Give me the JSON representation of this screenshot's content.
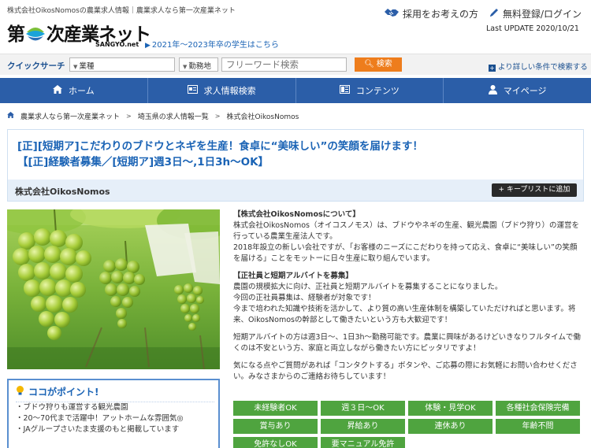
{
  "header": {
    "tagline": "株式会社OikosNomosの農業求人情報｜農業求人なら第一次産業ネット",
    "logo_text_pre": "第",
    "logo_text_post": "次産業ネット",
    "logo_sub": "SANGYO.net",
    "grad_link": "2021年〜2023年卒の学生はこちら",
    "adopt_link": "採用をお考えの方",
    "login_link": "無料登録/ログイン",
    "last_update": "Last UPDATE 2020/10/21"
  },
  "search": {
    "label": "クイックサーチ",
    "industry": "業種",
    "location": "勤務地",
    "keyword_placeholder": "フリーワード検索",
    "button": "検索",
    "detail_link": "より詳しい条件で検索する"
  },
  "nav": {
    "items": [
      {
        "label": "ホーム",
        "icon": "home-icon"
      },
      {
        "label": "求人情報検索",
        "icon": "job-search-icon"
      },
      {
        "label": "コンテンツ",
        "icon": "contents-icon"
      },
      {
        "label": "マイページ",
        "icon": "user-icon"
      }
    ]
  },
  "breadcrumb": [
    "農業求人なら第一次産業ネット",
    "埼玉県の求人情報一覧",
    "株式会社OikosNomos"
  ],
  "job": {
    "title_line1": "[正][短期ア]こだわりのブドウとネギを生産！食卓に“美味しい”の笑顔を届けます！",
    "title_line2": "【[正]経験者募集／[短期ア]週3日〜,1日3h〜OK】",
    "company": "株式会社OikosNomos",
    "keep_button": "キープリストに追加"
  },
  "point": {
    "title": "ココがポイント!",
    "items": [
      "・ブドウ狩りも運営する観光農園",
      "・20〜70代まで活躍中！アットホームな雰囲気◎",
      "・JAグループさいたま支援のもと掲載しています"
    ]
  },
  "description": {
    "about_heading": "【株式会社OikosNomosについて】",
    "about_p1": "株式会社OikosNomos（オイコスノモス）は、ブドウやネギの生産、観光農園（ブドウ狩り）の運営を行っている農業生産法人です。",
    "about_p2": "2018年設立の新しい会社ですが、「お客様のニーズにこだわりを持って応え、食卓に“美味しい”の笑顔を届ける」ことをモットーに日々生産に取り組んでいます。",
    "recruit_heading": "【正社員と短期アルバイトを募集】",
    "recruit_p1": "農園の規模拡大に向け、正社員と短期アルバイトを募集することになりました。",
    "recruit_p2": "今回の正社員募集は、経験者が対象です！",
    "recruit_p3": "今まで培われた知識や技術を活かして、より質の高い生産体制を構築していただければと思います。将来、OikosNomosの幹部として働きたいという方も大歓迎です！",
    "parttime_p": "短期アルバイトの方は週3日〜、1日3h〜勤務可能です。農業に興味があるけどいきなりフルタイムで働くのは不安という方、家庭と両立しながら働きたい方にピッタリですよ！",
    "contact_p": "気になる点やご質問があれば「コンタクトする」ボタンや、ご応募の際にお気軽にお問い合わせください。みなさまからのご連絡お待ちしています！"
  },
  "tags": [
    "未経験者OK",
    "週３日〜OK",
    "体験・見学OK",
    "各種社会保険完備",
    "賞与あり",
    "昇給あり",
    "連休あり",
    "年齢不問",
    "免許なしOK",
    "要マニュアル免許"
  ],
  "colors": {
    "primary_blue": "#2b5ea8",
    "title_blue": "#1a63b5",
    "search_orange": "#ee7d1c",
    "tag_green": "#4fa43f"
  }
}
